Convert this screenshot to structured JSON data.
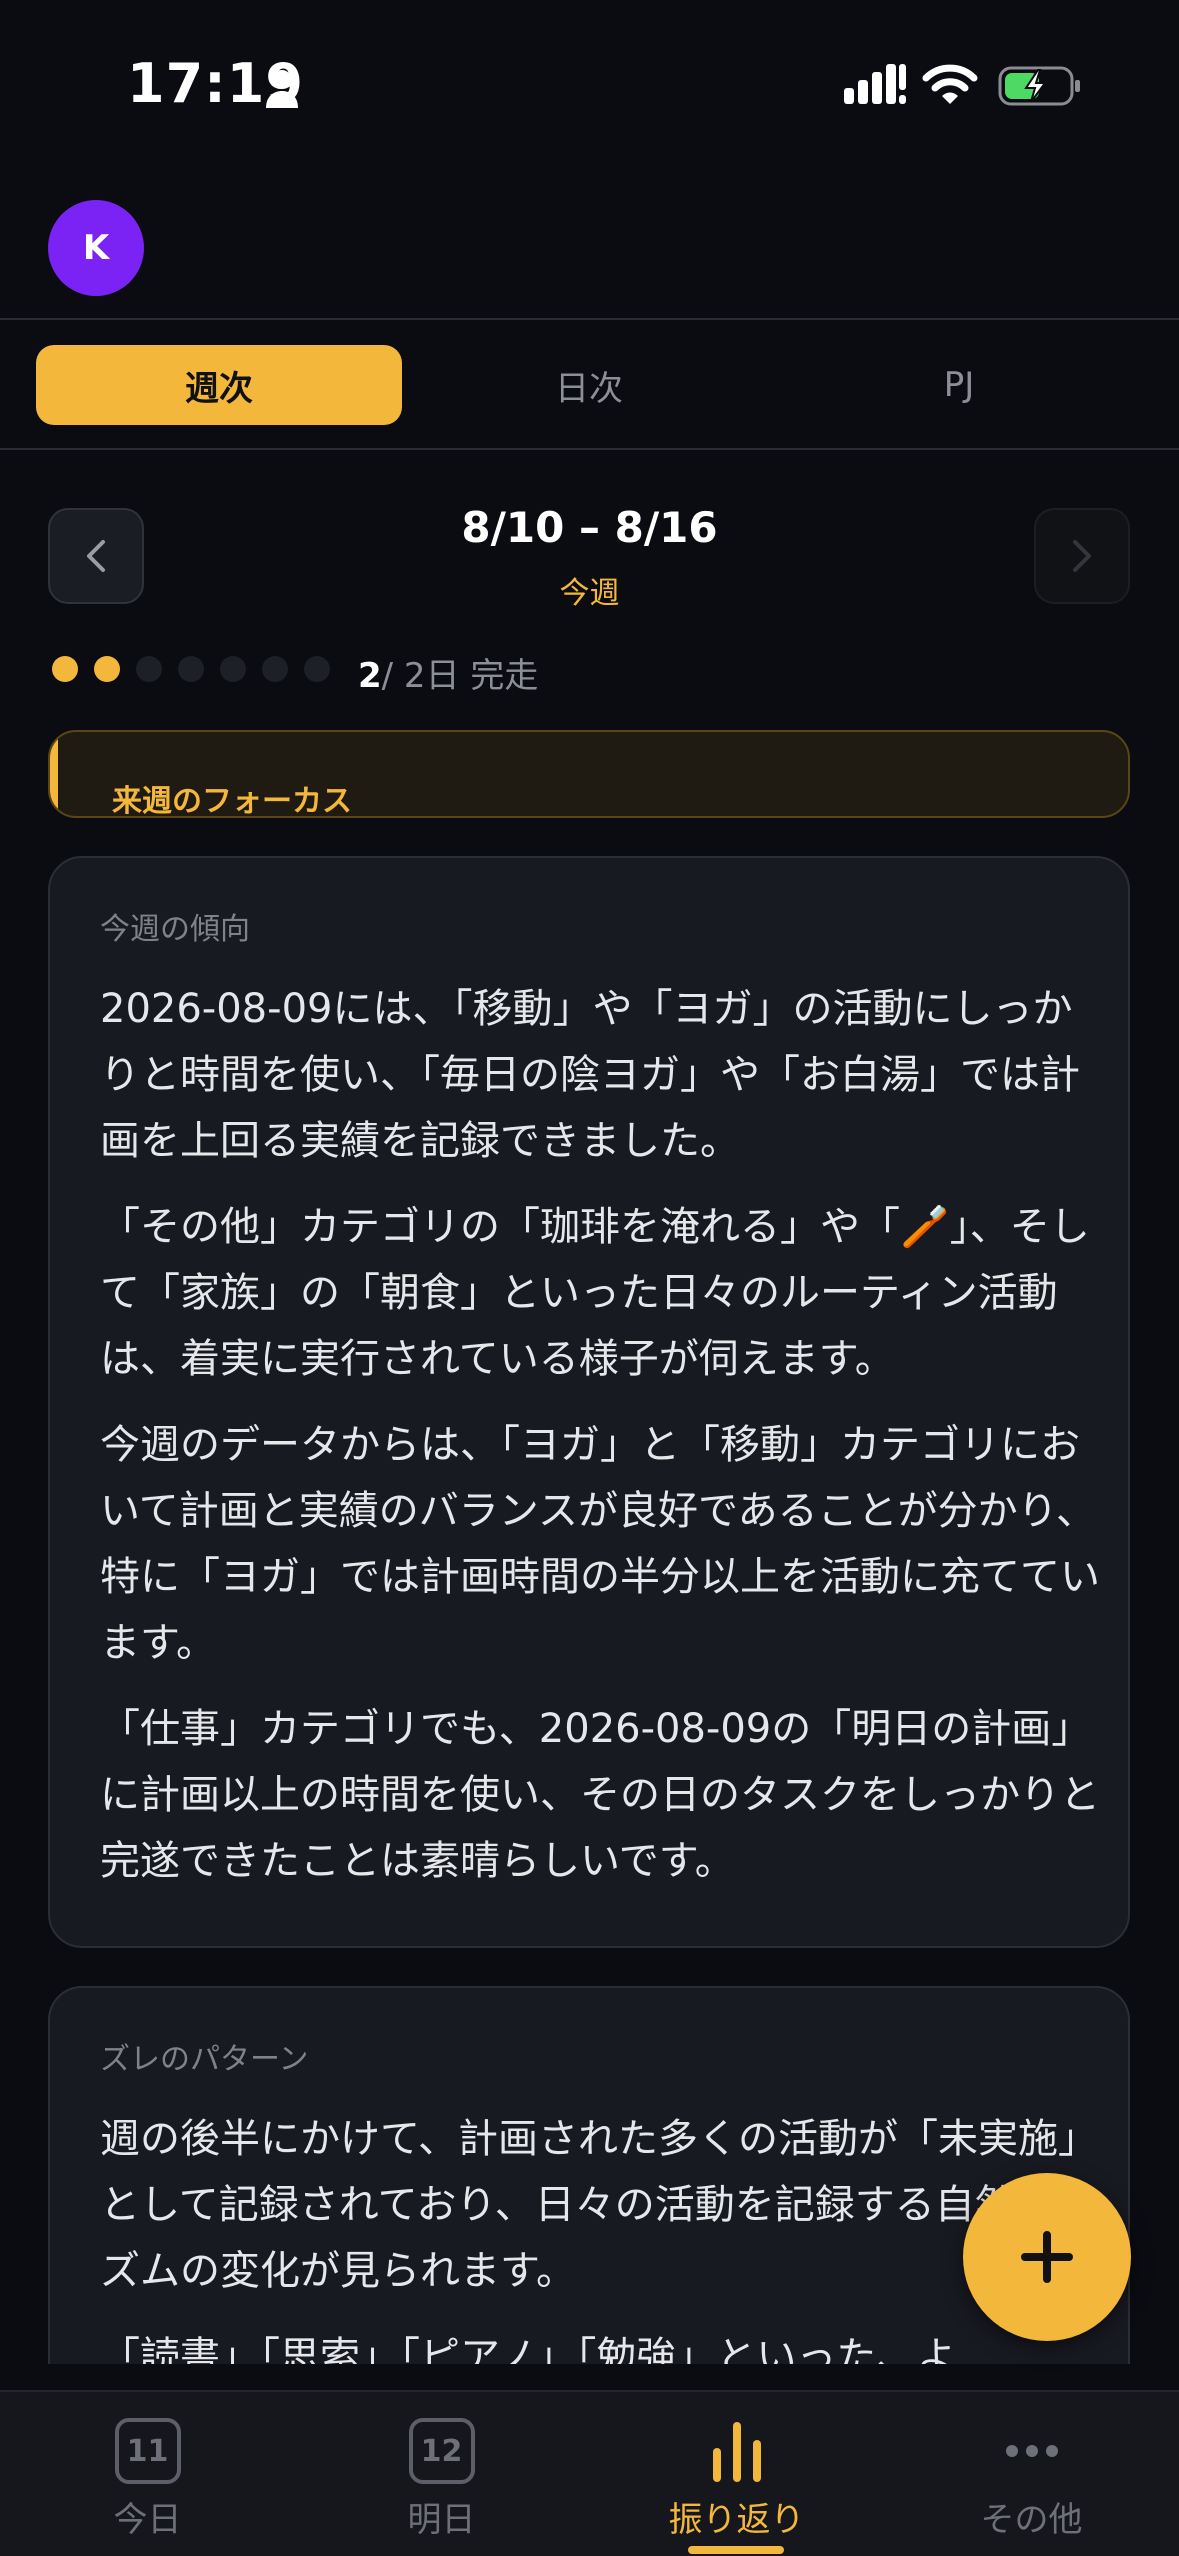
{
  "status_bar": {
    "time": "17:19"
  },
  "profile": {
    "avatar_initial": "K"
  },
  "tabs": [
    {
      "label": "週次",
      "active": true
    },
    {
      "label": "日次",
      "active": false
    },
    {
      "label": "PJ",
      "active": false
    }
  ],
  "week": {
    "range": "8/10 – 8/16",
    "subtitle": "今週",
    "completed_days": 2,
    "total_days_label": "/ 2日 完走",
    "dots_done": 2,
    "dots_total": 7
  },
  "focus": {
    "label": "来週のフォーカス"
  },
  "trend_card": {
    "label": "今週の傾向",
    "paragraphs": [
      "2026-08-09には、「移動」や「ヨガ」の活動にしっかりと時間を使い、「毎日の陰ヨガ」や「お白湯」では計画を上回る実績を記録できました。",
      "「その他」カテゴリの「珈琲を淹れる」や「🪥」、そして「家族」の「朝食」といった日々のルーティン活動は、着実に実行されている様子が伺えます。",
      "今週のデータからは、「ヨガ」と「移動」カテゴリにおいて計画と実績のバランスが良好であることが分かり、特に「ヨガ」では計画時間の半分以上を活動に充てています。",
      "「仕事」カテゴリでも、2026-08-09の「明日の計画」に計画以上の時間を使い、その日のタスクをしっかりと完遂できたことは素晴らしいです。"
    ]
  },
  "gap_card": {
    "label": "ズレのパターン",
    "paragraphs": [
      "週の後半にかけて、計画された多くの活動が「未実施」として記録されており、日々の活動を記録する自然なリズムの変化が見られます。",
      "「読書」「思索」「ピアノ」「勉強」といった、よ"
    ]
  },
  "bottom_nav": [
    {
      "label": "今日",
      "icon": "calendar-day-icon",
      "day": "11",
      "active": false
    },
    {
      "label": "明日",
      "icon": "calendar-day-icon",
      "day": "12",
      "active": false
    },
    {
      "label": "振り返り",
      "icon": "bar-chart-icon",
      "active": true
    },
    {
      "label": "その他",
      "icon": "more-icon",
      "active": false
    }
  ],
  "colors": {
    "accent": "#f3b73b",
    "avatar": "#7b22f5",
    "background": "#0b0c11",
    "card": "#181a21"
  }
}
